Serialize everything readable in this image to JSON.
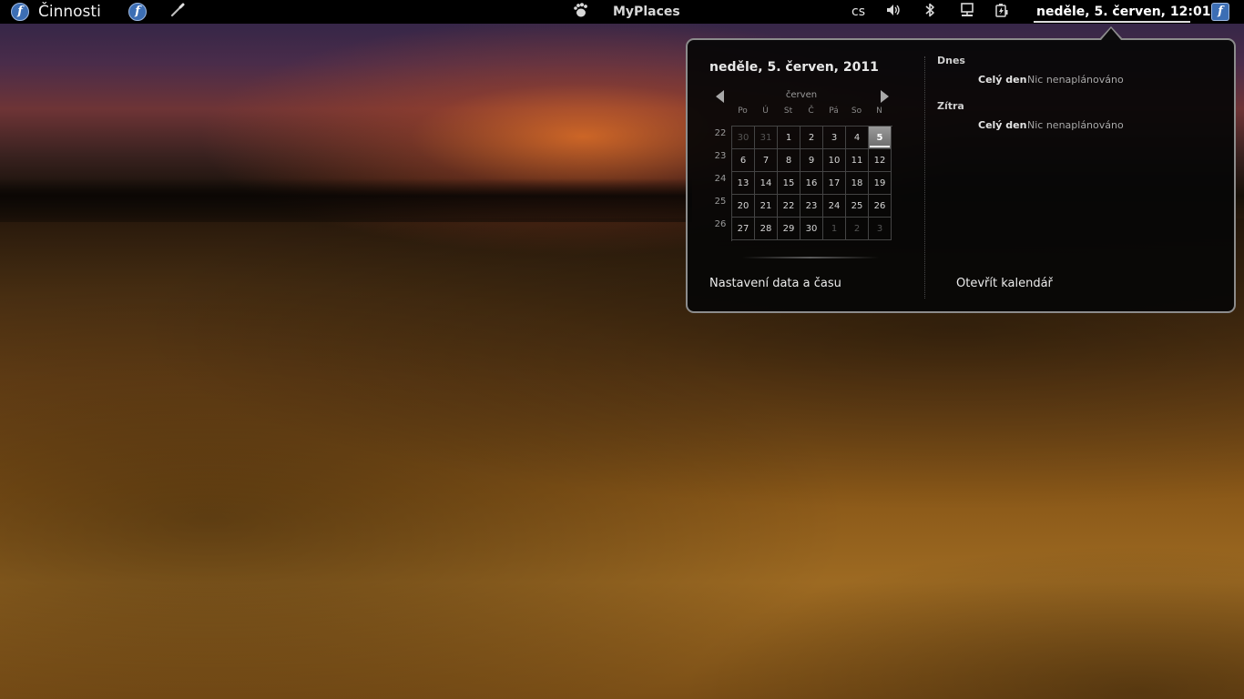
{
  "panel": {
    "activities_label": "Činnosti",
    "myplaces_label": "MyPlaces",
    "keyboard_layout": "cs",
    "clock_label": "neděle,  5. červen, 12:01",
    "fedora_glyph": "f",
    "icons": [
      "fedora-icon",
      "brush-icon",
      "gnome-foot-icon",
      "volume-icon",
      "bluetooth-icon",
      "network-icon",
      "battery-icon"
    ]
  },
  "calendar": {
    "date_heading": "neděle,  5. červen, 2011",
    "month": "červen",
    "weekdays": [
      "Po",
      "Ú",
      "St",
      "Č",
      "Pá",
      "So",
      "N"
    ],
    "week_numbers": [
      "22",
      "23",
      "24",
      "25",
      "26"
    ],
    "weeks": [
      [
        "30",
        "31",
        "1",
        "2",
        "3",
        "4",
        "5"
      ],
      [
        "6",
        "7",
        "8",
        "9",
        "10",
        "11",
        "12"
      ],
      [
        "13",
        "14",
        "15",
        "16",
        "17",
        "18",
        "19"
      ],
      [
        "20",
        "21",
        "22",
        "23",
        "24",
        "25",
        "26"
      ],
      [
        "27",
        "28",
        "29",
        "30",
        "1",
        "2",
        "3"
      ]
    ],
    "today": "5",
    "settings_label": "Nastavení data a času"
  },
  "events": {
    "today_heading": "Dnes",
    "today_time": "Celý den",
    "today_desc": "Nic nenaplánováno",
    "tomorrow_heading": "Zítra",
    "tomorrow_time": "Celý den",
    "tomorrow_desc": "Nic nenaplánováno",
    "open_calendar_label": "Otevřít kalendář"
  },
  "colors": {
    "panel_bg": "#000000",
    "popup_border": "#8c8c8c",
    "today_cell": "#8a8a8a",
    "fedora_blue": "#3c6eb4"
  }
}
